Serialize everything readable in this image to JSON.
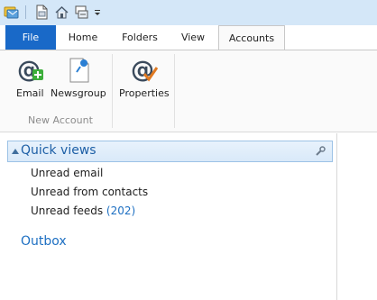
{
  "quick_access": {
    "icons": [
      "app-icon",
      "new-item-icon",
      "home-icon",
      "send-receive-icon",
      "customize-dropdown-icon"
    ]
  },
  "tabs": {
    "file": "File",
    "home": "Home",
    "folders": "Folders",
    "view": "View",
    "accounts": "Accounts",
    "active": "Accounts"
  },
  "ribbon": {
    "new_account_group": {
      "label": "New Account",
      "email_label": "Email",
      "newsgroup_label": "Newsgroup"
    },
    "properties_label": "Properties"
  },
  "navigation": {
    "quick_views": {
      "title": "Quick views",
      "items": [
        {
          "label": "Unread email",
          "count": ""
        },
        {
          "label": "Unread from contacts",
          "count": ""
        },
        {
          "label": "Unread feeds",
          "count": "(202)"
        }
      ]
    },
    "outbox_label": "Outbox"
  },
  "colors": {
    "file_tab": "#1969c8",
    "accent_text": "#1d6fc2",
    "qat_background": "#d4e7f8"
  }
}
